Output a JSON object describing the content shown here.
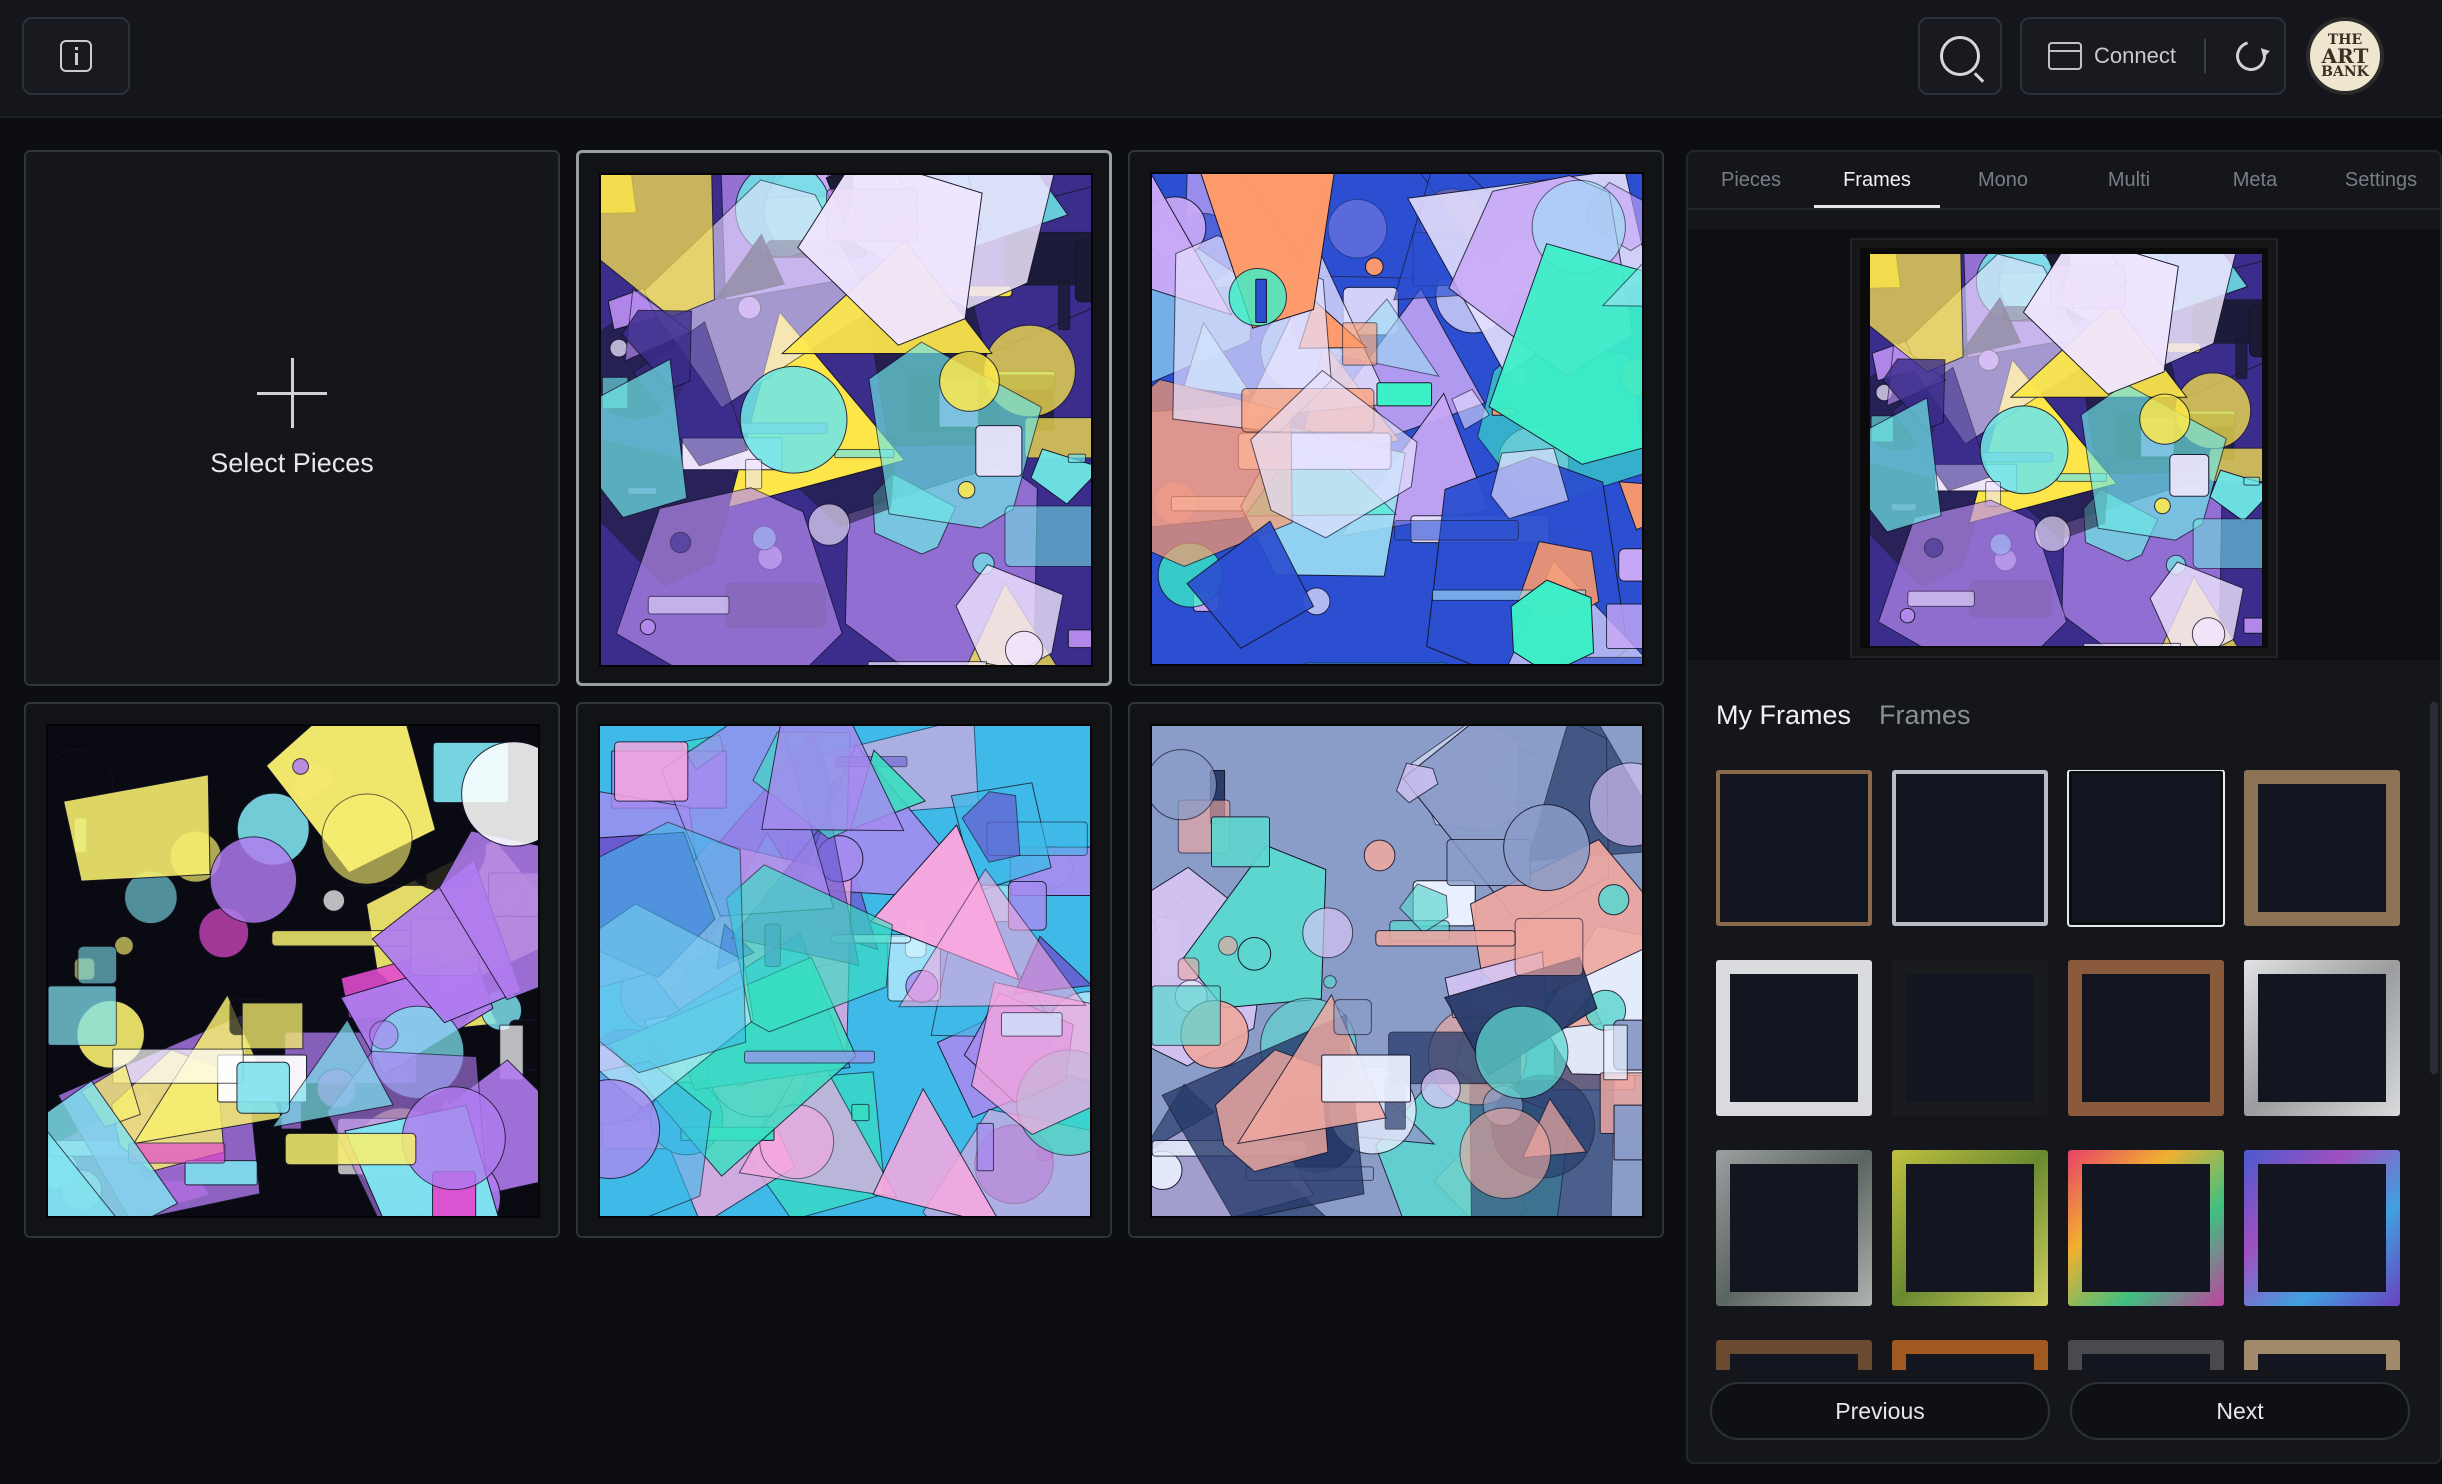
{
  "topbar": {
    "info_icon": "info-icon",
    "search_icon": "search-icon",
    "connect_label": "Connect",
    "refresh_icon": "refresh-icon",
    "avatar_text": [
      "THE",
      "ART",
      "BANK"
    ]
  },
  "gallery": {
    "add_label": "Select Pieces",
    "tiles": [
      {
        "kind": "add"
      },
      {
        "kind": "art",
        "selected": true,
        "palette": [
          "#3b2d8c",
          "#b88cf0",
          "#6fe6e6",
          "#f0e6ff",
          "#ffe94a",
          "#1a1a33"
        ]
      },
      {
        "kind": "art",
        "selected": false,
        "palette": [
          "#2b4fd0",
          "#9de0f5",
          "#c9a9f7",
          "#ff9b6b",
          "#3cf0c8",
          "#e8e2ff"
        ]
      },
      {
        "kind": "art",
        "selected": false,
        "palette": [
          "#0a0a12",
          "#e14ad0",
          "#7fe3f0",
          "#f8f070",
          "#b07cf0",
          "#ffffff"
        ]
      },
      {
        "kind": "art",
        "selected": false,
        "palette": [
          "#3fb9e8",
          "#a58cf0",
          "#c9f2ff",
          "#6a5ad0",
          "#f9a8e0",
          "#38e0c0"
        ]
      },
      {
        "kind": "art",
        "selected": false,
        "palette": [
          "#8a9cc8",
          "#d6c5f5",
          "#5ed6d0",
          "#f0a8a0",
          "#263a6a",
          "#eaf0ff"
        ]
      }
    ]
  },
  "panel": {
    "tabs": [
      "Pieces",
      "Frames",
      "Mono",
      "Multi",
      "Meta",
      "Settings"
    ],
    "active_tab": "Frames",
    "sub_tabs": [
      "My Frames",
      "Frames"
    ],
    "active_sub_tab": "My Frames",
    "frames": [
      {
        "color": "#8a6a4a",
        "style": "thin"
      },
      {
        "color": "#b8bcc4",
        "style": "thin"
      },
      {
        "color": "#0c0d10",
        "style": "black",
        "selected": true
      },
      {
        "color": "#8c7354",
        "style": "wood"
      },
      {
        "color": "#d9dbde",
        "style": "silver"
      },
      {
        "color": "#1a1b1f",
        "style": "dark"
      },
      {
        "color": "#8a5a3c",
        "style": "copper"
      },
      {
        "color": "#b9bbbe",
        "style": "marble"
      },
      {
        "color": "#7d8780",
        "style": "stone"
      },
      {
        "color": "#9ca040",
        "style": "green-gold"
      },
      {
        "color": "#c0406a",
        "style": "rainbow"
      },
      {
        "color": "#5a6ad0",
        "style": "blue-rainbow"
      },
      {
        "color": "#6a4a30",
        "style": "wood"
      },
      {
        "color": "#a05a20",
        "style": "amber"
      },
      {
        "color": "#4a4a4e",
        "style": "dark"
      },
      {
        "color": "#a08a6a",
        "style": "light-wood"
      }
    ],
    "prev_label": "Previous",
    "next_label": "Next"
  }
}
